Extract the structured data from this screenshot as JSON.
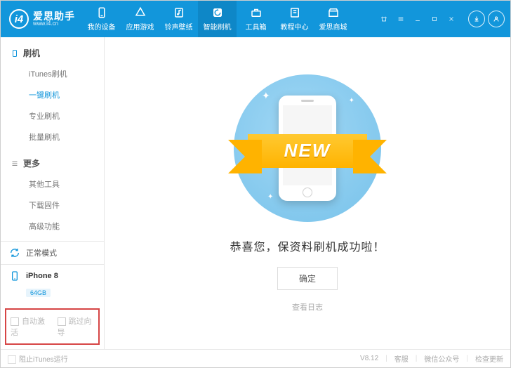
{
  "brand": {
    "name": "爱思助手",
    "url": "www.i4.cn",
    "badge": "i4"
  },
  "nav": {
    "items": [
      {
        "label": "我的设备",
        "icon": "phone"
      },
      {
        "label": "应用游戏",
        "icon": "apps"
      },
      {
        "label": "铃声壁纸",
        "icon": "note"
      },
      {
        "label": "智能刷机",
        "icon": "flash",
        "active": true
      },
      {
        "label": "工具箱",
        "icon": "toolbox"
      },
      {
        "label": "教程中心",
        "icon": "book"
      },
      {
        "label": "爱思商城",
        "icon": "shop"
      }
    ]
  },
  "sidebar": {
    "flash": {
      "title": "刷机",
      "items": [
        "iTunes刷机",
        "一键刷机",
        "专业刷机",
        "批量刷机"
      ],
      "activeIndex": 1
    },
    "more": {
      "title": "更多",
      "items": [
        "其他工具",
        "下载固件",
        "高级功能"
      ]
    }
  },
  "status": {
    "mode": "正常模式",
    "device": "iPhone 8",
    "capacity": "64GB"
  },
  "options": {
    "autoActivate": "自动激活",
    "skipWizard": "跳过向导"
  },
  "main": {
    "ribbon": "NEW",
    "success": "恭喜您，保资料刷机成功啦！",
    "confirm": "确定",
    "viewLog": "查看日志"
  },
  "footer": {
    "blockItunes": "阻止iTunes运行",
    "version": "V8.12",
    "support": "客服",
    "wechat": "微信公众号",
    "update": "检查更新"
  }
}
